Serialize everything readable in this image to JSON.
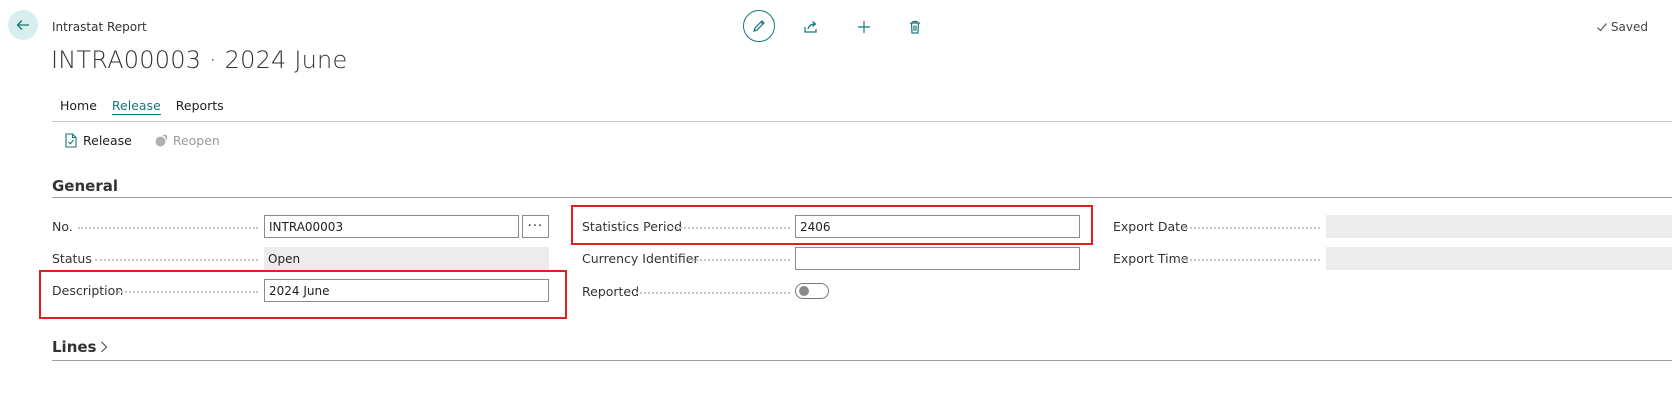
{
  "header": {
    "page_kind": "Intrastat Report",
    "title": "INTRA00003 · 2024 June",
    "saved_label": "Saved"
  },
  "tabs": [
    {
      "label": "Home"
    },
    {
      "label": "Release",
      "active": true
    },
    {
      "label": "Reports"
    }
  ],
  "actions": {
    "release": "Release",
    "reopen": "Reopen"
  },
  "general": {
    "section_title": "General",
    "no": {
      "label": "No.",
      "value": "INTRA00003"
    },
    "status": {
      "label": "Status",
      "value": "Open"
    },
    "description": {
      "label": "Description",
      "value": "2024 June"
    },
    "statistics_period": {
      "label": "Statistics Period",
      "value": "2406"
    },
    "currency_identifier": {
      "label": "Currency Identifier",
      "value": ""
    },
    "reported": {
      "label": "Reported",
      "value": false
    },
    "export_date": {
      "label": "Export Date",
      "value": ""
    },
    "export_time": {
      "label": "Export Time",
      "value": ""
    }
  },
  "lines": {
    "section_title": "Lines"
  },
  "colors": {
    "accent": "#16777a",
    "highlight": "#e0201a"
  }
}
